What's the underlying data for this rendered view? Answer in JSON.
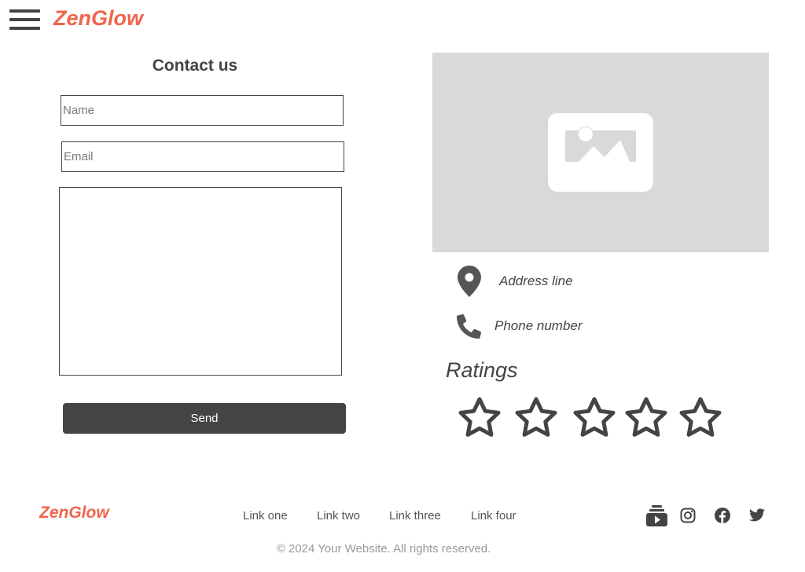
{
  "header": {
    "brand": "ZenGlow",
    "menu_icon": "hamburger-menu-icon"
  },
  "contact": {
    "title": "Contact us",
    "name_placeholder": "Name",
    "email_placeholder": "Email",
    "message_value": "",
    "send_label": "Send"
  },
  "info": {
    "image_icon": "image-placeholder-icon",
    "address_icon": "map-marker-icon",
    "address": "Address line",
    "phone_icon": "phone-icon",
    "phone": "Phone number"
  },
  "ratings": {
    "title": "Ratings",
    "max": 5,
    "selected": 0,
    "star_icon": "star-outline-icon"
  },
  "footer": {
    "brand": "ZenGlow",
    "links": [
      "Link one",
      "Link two",
      "Link three",
      "Link four"
    ],
    "social_icons": [
      "youtube-subscriptions-icon",
      "instagram-icon",
      "facebook-icon",
      "twitter-icon"
    ],
    "copyright": "© 2024 Your Website. All rights reserved."
  },
  "colors": {
    "brand": "#f0644b",
    "text": "#444444",
    "button": "#444444",
    "placeholder_bg": "#d9d9d9"
  }
}
